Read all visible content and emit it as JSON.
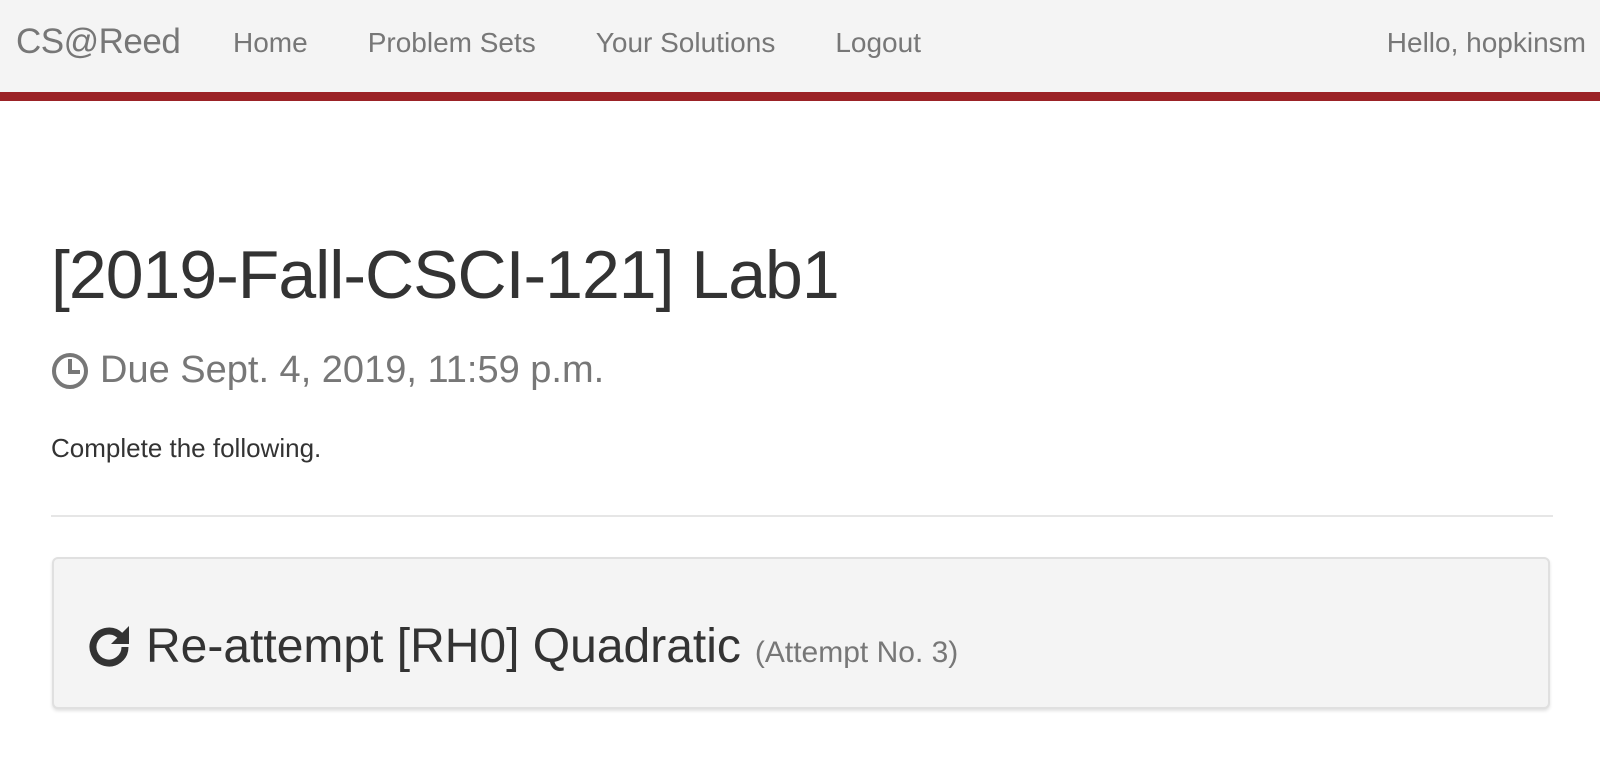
{
  "navbar": {
    "brand": "CS@Reed",
    "links": [
      {
        "label": "Home"
      },
      {
        "label": "Problem Sets"
      },
      {
        "label": "Your Solutions"
      },
      {
        "label": "Logout"
      }
    ],
    "greeting": "Hello, hopkinsm",
    "accent_color": "#9b2226"
  },
  "main": {
    "title": "[2019-Fall-CSCI-121] Lab1",
    "due": {
      "icon": "clock-icon",
      "text": "Due Sept. 4, 2019, 11:59 p.m."
    },
    "description": "Complete the following.",
    "attempt": {
      "icon": "refresh-icon",
      "label": "Re-attempt [RH0] Quadratic",
      "attempt_number": "(Attempt No. 3)"
    }
  }
}
